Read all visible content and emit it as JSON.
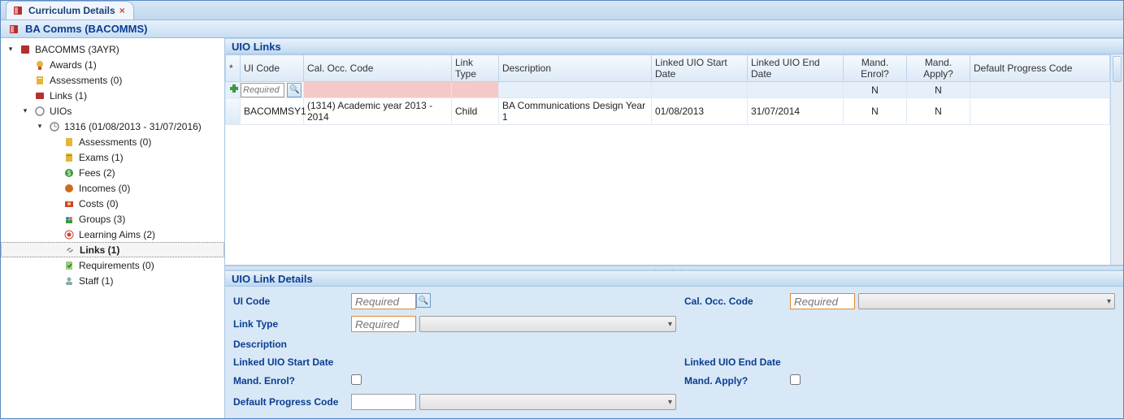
{
  "tab": {
    "title": "Curriculum Details"
  },
  "title": "BA Comms (BACOMMS)",
  "tree": {
    "root": {
      "label": "BACOMMS (3AYR)"
    },
    "awards": {
      "label": "Awards (1)"
    },
    "assessments": {
      "label": "Assessments (0)"
    },
    "links": {
      "label": "Links (1)"
    },
    "uios": {
      "label": "UIOs"
    },
    "uio1316": {
      "label": "1316 (01/08/2013 - 31/07/2016)"
    },
    "uio_assessments": {
      "label": "Assessments (0)"
    },
    "uio_exams": {
      "label": "Exams (1)"
    },
    "uio_fees": {
      "label": "Fees (2)"
    },
    "uio_incomes": {
      "label": "Incomes (0)"
    },
    "uio_costs": {
      "label": "Costs (0)"
    },
    "uio_groups": {
      "label": "Groups (3)"
    },
    "uio_learning_aims": {
      "label": "Learning Aims (2)"
    },
    "uio_links": {
      "label": "Links (1)"
    },
    "uio_requirements": {
      "label": "Requirements (0)"
    },
    "uio_staff": {
      "label": "Staff (1)"
    }
  },
  "sections": {
    "grid_title": "UIO Links",
    "details_title": "UIO Link Details"
  },
  "grid": {
    "columns": {
      "rowmark": "*",
      "ui_code": "UI Code",
      "cal_occ": "Cal. Occ. Code",
      "link_type": "Link Type",
      "description": "Description",
      "start": "Linked UIO Start Date",
      "end": "Linked UIO End Date",
      "mand_enrol": "Mand. Enrol?",
      "mand_apply": "Mand. Apply?",
      "prog_code": "Default Progress Code"
    },
    "new_row": {
      "ui_code_placeholder": "Required",
      "mand_enrol": "N",
      "mand_apply": "N"
    },
    "rows": [
      {
        "ui_code": "BACOMMSY1",
        "cal_occ": "(1314) Academic year 2013 - 2014",
        "link_type": "Child",
        "description": "BA Communications Design Year 1",
        "start": "01/08/2013",
        "end": "31/07/2014",
        "mand_enrol": "N",
        "mand_apply": "N",
        "prog_code": ""
      }
    ]
  },
  "details": {
    "labels": {
      "ui_code": "UI Code",
      "cal_occ": "Cal. Occ. Code",
      "link_type": "Link Type",
      "description": "Description",
      "start": "Linked UIO Start Date",
      "end": "Linked UIO End Date",
      "mand_enrol": "Mand. Enrol?",
      "mand_apply": "Mand. Apply?",
      "prog_code": "Default Progress Code"
    },
    "required_placeholder": "Required"
  }
}
